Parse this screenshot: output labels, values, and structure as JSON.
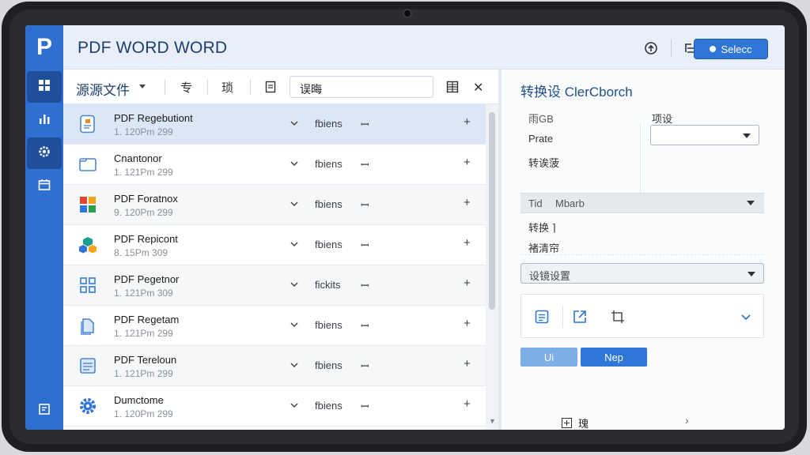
{
  "app": {
    "logo": "P",
    "title": "PDF WORD WORD",
    "select_button": "Selecc"
  },
  "file_panel": {
    "title": "源源文件",
    "tools": [
      "专",
      "琐"
    ],
    "search_value": "误晦",
    "rows": [
      {
        "name": "PDF Regebutiont",
        "date": "1. 120Pm 299",
        "status": "fbiens",
        "action": "ꟷ",
        "selected": true
      },
      {
        "name": "Cnantonor",
        "date": "1. 121Pm 299",
        "status": "fbiens",
        "action": "ꟷ",
        "selected": false
      },
      {
        "name": "PDF Foratnox",
        "date": "9. 120Pm 299",
        "status": "fbiens",
        "action": "ꟷ",
        "selected": false
      },
      {
        "name": "PDF Repicont",
        "date": "8. 15Pm 309",
        "status": "fbiens",
        "action": "ꟷ",
        "selected": false
      },
      {
        "name": "PDF Pegetnor",
        "date": "1. 121Pm 309",
        "status": "fickits",
        "action": "ꟷ",
        "selected": false
      },
      {
        "name": "PDF Regetam",
        "date": "1. 121Pm 299",
        "status": "fbiens",
        "action": "ꟷ",
        "selected": false
      },
      {
        "name": "PDF Tereloun",
        "date": "1. 121Pm 299",
        "status": "fbiens",
        "action": "ꟷ",
        "selected": false
      },
      {
        "name": "Dumctome",
        "date": "1. 120Pm 299",
        "status": "fbiens",
        "action": "ꟷ",
        "selected": false
      }
    ]
  },
  "settings_panel": {
    "title": "转换设 ClerCborch",
    "label_top_left": "雨GB",
    "label_top_right": "项设",
    "item_prate": "Prate",
    "item_convert_setting": "转诶菠",
    "gray_row_a": "Tid",
    "gray_row_b": "Mbarb",
    "item_convert": "转换 ⌉",
    "item_clean": "褚清帘",
    "dropdown2_value": "设镜设置",
    "buttons": {
      "u": "Ui",
      "n": "Nep"
    },
    "bottom_item": "瑰"
  },
  "colors": {
    "rail": "#2f6fcf",
    "accent": "#2f76d6",
    "selected_row": "#dbe6f6"
  },
  "icons": {
    "rail": [
      "grid-icon",
      "bar-chart-icon",
      "gear-icon",
      "calendar-icon",
      "list-icon"
    ],
    "topbar": [
      "sync-icon",
      "list-filter-icon"
    ],
    "panel_toolbar": [
      "document-icon",
      "grid-view-icon",
      "close-icon"
    ]
  }
}
